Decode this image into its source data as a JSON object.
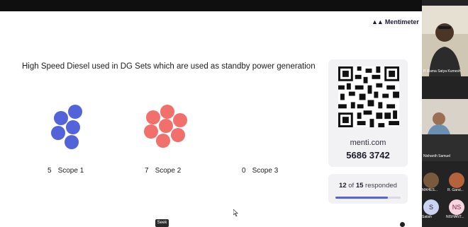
{
  "brand": {
    "name": "Mentimeter"
  },
  "slide": {
    "question": "High Speed Diesel used in DG Sets which are used as standby power generation",
    "options": [
      {
        "count": "5",
        "label": "Scope 1",
        "color": "#5363d9"
      },
      {
        "count": "7",
        "label": "Scope 2",
        "color": "#f2706c"
      },
      {
        "count": "0",
        "label": "Scope 3",
        "color": "#8c8c8c"
      }
    ]
  },
  "join": {
    "url": "menti.com",
    "code": "5686 3742"
  },
  "responses": {
    "count": "12",
    "of": "of",
    "total": "15",
    "suffix": "responded",
    "fraction": 0.8,
    "accent": "#5363d9"
  },
  "tooltip": {
    "seek": "Seek"
  },
  "participants": [
    {
      "name": "P. Rama Satya Kumesh"
    },
    {
      "name": "Nishanth Samuel"
    },
    {
      "name": "MAHES...",
      "initials": ""
    },
    {
      "name": "R. Gand...",
      "initials": ""
    },
    {
      "name": "Satish",
      "initials": "S"
    },
    {
      "name": "NISHANT...",
      "initials": "NS"
    }
  ]
}
